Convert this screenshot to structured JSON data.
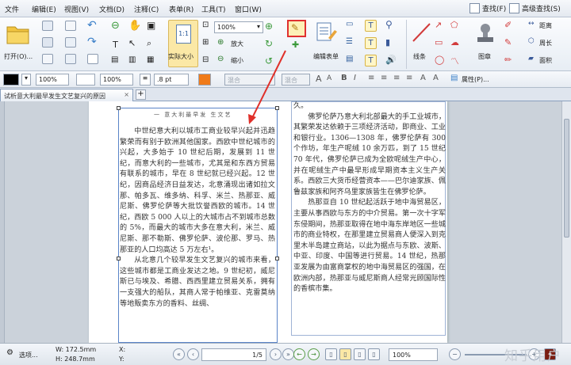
{
  "menu": [
    "文件",
    "编辑(E)",
    "视图(V)",
    "文档(D)",
    "注释(C)",
    "表单(R)",
    "工具(T)",
    "窗口(W)"
  ],
  "menu_right": {
    "find": "查找(F)",
    "advanced_find": "高级查找(S)"
  },
  "ribbon": {
    "open": "打开(O)...",
    "actual_size": "实际大小",
    "zoom_value": "100%",
    "zoom_in": "放大",
    "zoom_out": "缩小",
    "edit_form": "编辑表单",
    "line": "线条",
    "image": "图章",
    "distance": "距离",
    "perimeter": "周长",
    "area": "面积"
  },
  "format": {
    "opacity1": "100%",
    "opacity2": "100%",
    "line_width": ".8 pt",
    "blend1": "混合",
    "blend2": "混合",
    "properties": "属性(P)..."
  },
  "tab": {
    "title": "试析意大利最早发生文艺复兴的原因",
    "add": "+"
  },
  "document": {
    "header": "一  意大利最早发  生文艺",
    "left_paragraphs": [
      "中世纪意大利以城市工商业较早兴起并迅趋繁荣而有别于欧洲其他国家。西欧中世纪城市的兴起，大多始于 10 世纪后期，发展到 11 世纪，而意大利的一些城市，尤其是和东西方贸易有联系的城市，早在 8 世纪就已经兴起。12 世纪，因商品经济日益发达，北意涌现出诸如拉文那、帕多瓦、维多纳、科孚、米兰、热那亚、威尼斯、佛罗伦萨等大批饮誉西欧的城市。14 世纪，西欧 5 000 人以上的大城市占不到城市总数的 5%，而最大的城市大多在意大利，米兰、威尼斯、那不勒斯、佛罗伦萨、波伦那、罗马、热那亚的人口均高达 5 万左右¹。",
      "从北意几个较早发生文艺复兴的城市来看，这些城市都是工商业发达之地。9 世纪初，威尼斯已与埃及、希腊、西西里建立贸易关系，拥有一支强大的船队，其商人常于帕维亚、克雷莫纳等地贩卖东方的香料、丝绸、"
    ],
    "right_top": "久。",
    "right_paragraphs": [
      "佛罗伦萨乃意大利北部最大的手工业城市，其繁荣发达依赖于三项经济活动，即商业、工业和银行业。1306—1308 年，佛罗伦萨有 300 个作坊，年生产呢绒 10 余万匹，到了 15 世纪 70 年代，佛罗伦萨已成为全欧呢绒生产中心，并在呢绒生产中最早形成早期资本主义生产关系。西欧三大货币经营资本——巴尔迪家族、佩鲁兹家族和阿齐乌里家族皆生在佛罗伦萨。",
      "热那亚自 10 世纪起活跃于地中海贸易区，主要从事西欧与东方的中介贸易。第一次十字军东侵期间，热那亚取得在地中海东岸地区一些城市的商业特权，在那里建立贸易商人便深入到克里木半岛建立商站，以此为据点与东欧、波斯、中亚、印度、中国等进行贸易。14 世纪，热那亚发展为由富商掌权的地中海贸易区的强国，在欧洲内部，热那亚与威尼斯商人经常光顾国际性的香槟市集。"
    ]
  },
  "status": {
    "select": "选项...",
    "width": "W: 172.5mm",
    "height": "H: 248.7mm",
    "x": "X:",
    "y": "Y:",
    "page": "1/5",
    "zoom": "100%",
    "watermark": "知乎用户"
  }
}
